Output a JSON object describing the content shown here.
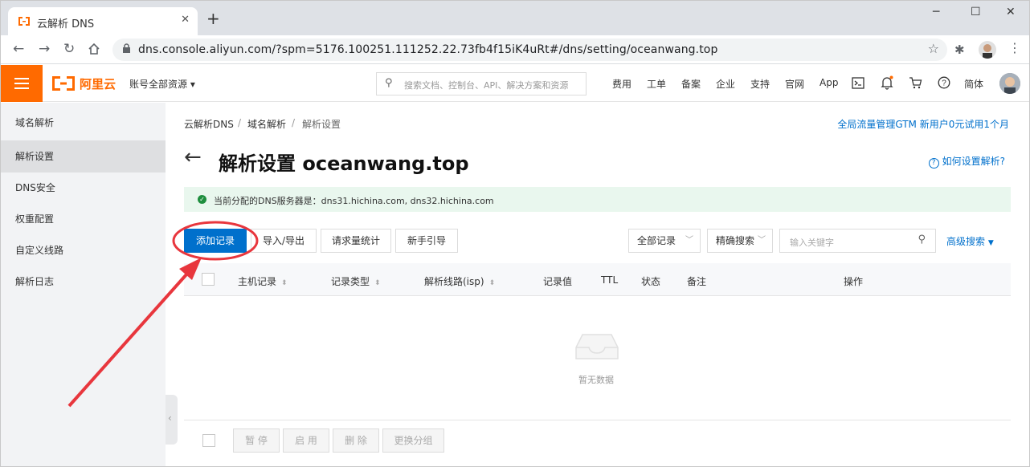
{
  "browser": {
    "tab_title": "云解析 DNS",
    "url": "dns.console.aliyun.com/?spm=5176.100251.111252.22.73fb4f15iK4uRt#/dns/setting/oceanwang.top"
  },
  "topbar": {
    "logo_text": "阿里云",
    "account_menu": "账号全部资源 ▾",
    "search_placeholder": "搜索文档、控制台、API、解决方案和资源",
    "nav": [
      "费用",
      "工单",
      "备案",
      "企业",
      "支持",
      "官网",
      "App"
    ],
    "language": "简体"
  },
  "sidebar": {
    "items": [
      {
        "label": "域名解析"
      },
      {
        "label": "解析设置"
      },
      {
        "label": "DNS安全"
      },
      {
        "label": "权重配置"
      },
      {
        "label": "自定义线路"
      },
      {
        "label": "解析日志"
      }
    ]
  },
  "breadcrumb": [
    "云解析DNS",
    "域名解析",
    "解析设置"
  ],
  "promo_link": "全局流量管理GTM 新用户0元试用1个月",
  "page": {
    "title": "解析设置 oceanwang.top",
    "help_link": "如何设置解析?"
  },
  "alert": {
    "text": "当前分配的DNS服务器是：dns31.hichina.com, dns32.hichina.com"
  },
  "actions": {
    "add_record": "添加记录",
    "import_export": "导入/导出",
    "request_stats": "请求量统计",
    "guide": "新手引导",
    "record_filter": "全部记录",
    "search_mode": "精确搜索",
    "keyword_placeholder": "输入关键字",
    "advanced_search": "高级搜索"
  },
  "table": {
    "columns": [
      "主机记录",
      "记录类型",
      "解析线路(isp)",
      "记录值",
      "TTL",
      "状态",
      "备注",
      "操作"
    ],
    "empty_text": "暂无数据"
  },
  "footer_actions": [
    "暂 停",
    "启 用",
    "删 除",
    "更换分组"
  ],
  "colors": {
    "brand_orange": "#ff6a00",
    "primary_blue": "#0070cc",
    "annotation_red": "#e8363d"
  }
}
